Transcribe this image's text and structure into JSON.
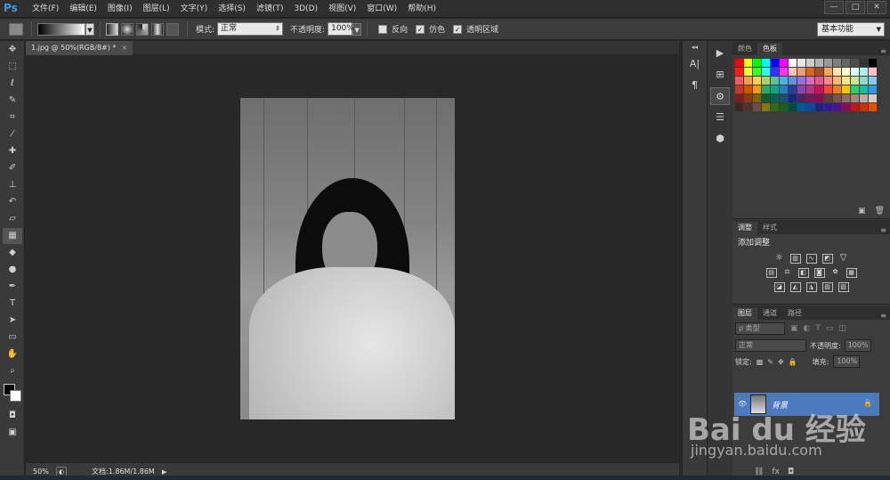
{
  "app": {
    "logo": "Ps"
  },
  "menubar": {
    "items": [
      "文件(F)",
      "编辑(E)",
      "图像(I)",
      "图层(L)",
      "文字(Y)",
      "选择(S)",
      "滤镜(T)",
      "3D(D)",
      "视图(V)",
      "窗口(W)",
      "帮助(H)"
    ],
    "window_controls": [
      "—",
      "□",
      "✕"
    ]
  },
  "options_bar": {
    "mode_label": "模式:",
    "mode_value": "正常",
    "opacity_label": "不透明度:",
    "opacity_value": "100%",
    "reverse_label": "反向",
    "dither_label": "仿色",
    "transparency_label": "透明区域",
    "workspace_value": "基本功能"
  },
  "document": {
    "tab_title": "1.jpg @ 50%(RGB/8#) *",
    "close": "×"
  },
  "status_bar": {
    "zoom": "50%",
    "doc_info": "文档:1.86M/1.86M"
  },
  "panels": {
    "swatches": {
      "tabs": [
        "颜色",
        "色板"
      ],
      "colors": [
        "#ff0000",
        "#ffff00",
        "#00ff00",
        "#00ffff",
        "#0000ff",
        "#ff00ff",
        "#ffffff",
        "#e6e6e6",
        "#cccccc",
        "#b3b3b3",
        "#999999",
        "#808080",
        "#666666",
        "#4d4d4d",
        "#333333",
        "#000000",
        "#ff1a1a",
        "#ffff33",
        "#33ff33",
        "#33ffff",
        "#3333ff",
        "#ff33ff",
        "#f2c9b0",
        "#e8a07a",
        "#d2691e",
        "#a0522d",
        "#f4a460",
        "#ffe4b5",
        "#fffacd",
        "#e0ffff",
        "#afeeee",
        "#ffc0cb",
        "#ed5d5d",
        "#f39c5b",
        "#f7d154",
        "#a9d36b",
        "#5fc0a0",
        "#4fb0d9",
        "#6b8fd6",
        "#9b6fd0",
        "#d06fb7",
        "#e05b8a",
        "#f28c8c",
        "#f5b77b",
        "#fbe38a",
        "#c7e59a",
        "#92d8c4",
        "#8ccbe8",
        "#c0392b",
        "#d35400",
        "#f39c12",
        "#27ae60",
        "#16a085",
        "#2980b9",
        "#2c3e90",
        "#8e44ad",
        "#b03a7e",
        "#c0175c",
        "#e74c3c",
        "#e67e22",
        "#f1c40f",
        "#2ecc71",
        "#1abc9c",
        "#3498db",
        "#7b1f1f",
        "#8a3b0e",
        "#7d6608",
        "#145a32",
        "#0e5e52",
        "#1b4f72",
        "#1a237e",
        "#4a235a",
        "#6e1b4f",
        "#880e4f",
        "#5d4037",
        "#795548",
        "#8d6e63",
        "#a1887f",
        "#bcaaa4",
        "#d7ccc8",
        "#3e2723",
        "#4e342e",
        "#6d4c41",
        "#827717",
        "#33691e",
        "#1b5e20",
        "#004d40",
        "#01579b",
        "#0d47a1",
        "#1a237e",
        "#311b92",
        "#4a148c",
        "#880e4f",
        "#b71c1c",
        "#bf360c",
        "#e65100"
      ],
      "footer_icons": [
        "new-swatch",
        "delete"
      ]
    },
    "adjustments": {
      "tabs": [
        "调整",
        "样式"
      ],
      "title": "添加调整"
    },
    "layers": {
      "tabs": [
        "图层",
        "通道",
        "路径"
      ],
      "filter_value": "ρ 类型",
      "blend_mode": "正常",
      "opacity_label": "不透明度:",
      "opacity_value": "100%",
      "lock_label": "锁定:",
      "fill_label": "填充:",
      "fill_value": "100%",
      "layer_name": "背景"
    }
  },
  "watermark": {
    "brand": "Bai du 经验",
    "url": "jingyan.baidu.com"
  }
}
